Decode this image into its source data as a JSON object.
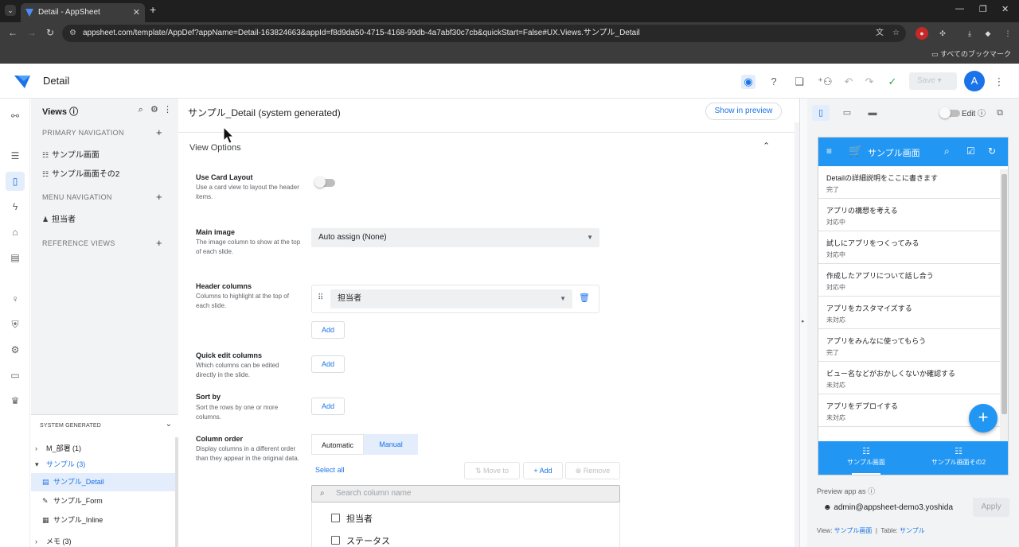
{
  "browser": {
    "tab_title": "Detail - AppSheet",
    "url": "appsheet.com/template/AppDef?appName=Detail-163824663&appId=f8d9da50-4715-4168-99db-4a7abf30c7cb&quickStart=False#UX.Views.サンプル_Detail",
    "bookmarks_label": "すべてのブックマーク"
  },
  "header": {
    "app_name": "Detail",
    "save_label": "Save",
    "avatar_letter": "A"
  },
  "views_panel": {
    "title": "Views",
    "primary_navigation": "PRIMARY NAVIGATION",
    "primary_items": [
      {
        "label": "サンプル画面"
      },
      {
        "label": "サンプル画面その2"
      }
    ],
    "menu_navigation": "MENU NAVIGATION",
    "menu_items": [
      {
        "label": "担当者"
      }
    ],
    "reference_views": "REFERENCE VIEWS",
    "system_generated": "SYSTEM GENERATED",
    "sys_items": [
      {
        "label": "M_部署 (1)"
      },
      {
        "label": "サンプル (3)"
      },
      {
        "label": "サンプル_Detail"
      },
      {
        "label": "サンプル_Form"
      },
      {
        "label": "サンプル_Inline"
      },
      {
        "label": "メモ (3)"
      }
    ]
  },
  "editor": {
    "view_name": "サンプル_Detail (system generated)",
    "show_in_preview": "Show in preview",
    "section_title": "View Options",
    "use_card_layout": {
      "label": "Use Card Layout",
      "desc": "Use a card view to layout the header items."
    },
    "main_image": {
      "label": "Main image",
      "desc": "The image column to show at the top of each slide.",
      "value": "Auto assign (None)"
    },
    "header_columns": {
      "label": "Header columns",
      "desc": "Columns to highlight at the top of each slide.",
      "value": "担当者"
    },
    "quick_edit": {
      "label": "Quick edit columns",
      "desc": "Which columns can be edited directly in the slide."
    },
    "sort_by": {
      "label": "Sort by",
      "desc": "Sort the rows by one or more columns."
    },
    "column_order": {
      "label": "Column order",
      "desc": "Display columns in a different order than they appear in the original data."
    },
    "add_label": "Add",
    "automatic": "Automatic",
    "manual": "Manual",
    "select_all": "Select all",
    "move_to": "Move to",
    "add_plus": "Add",
    "remove": "Remove",
    "search_placeholder": "Search column name",
    "columns": [
      {
        "label": "担当者"
      },
      {
        "label": "ステータス"
      }
    ]
  },
  "preview": {
    "edit_label": "Edit",
    "app_title": "サンプル画面",
    "rows": [
      {
        "title": "Detailの詳細説明をここに書きます",
        "status": "完了"
      },
      {
        "title": "アプリの構想を考える",
        "status": "対応中"
      },
      {
        "title": "試しにアプリをつくってみる",
        "status": "対応中"
      },
      {
        "title": "作成したアプリについて話し合う",
        "status": "対応中"
      },
      {
        "title": "アプリをカスタマイズする",
        "status": "未対応"
      },
      {
        "title": "アプリをみんなに使ってもらう",
        "status": "完了"
      },
      {
        "title": "ビュー名などがおかしくないか確認する",
        "status": "未対応"
      },
      {
        "title": "アプリをデプロイする",
        "status": "未対応"
      }
    ],
    "nav": [
      {
        "label": "サンプル画面"
      },
      {
        "label": "サンプル画面その2"
      }
    ],
    "preview_as": "Preview app as",
    "email": "admin@appsheet-demo3.yoshida",
    "apply": "Apply",
    "footer_view_label": "View:",
    "footer_view_value": "サンプル画面",
    "footer_sep": "|",
    "footer_table_label": "Table:",
    "footer_table_value": "サンプル"
  },
  "colors": {
    "accent": "#1a73e8",
    "appbar": "#2196f3"
  }
}
